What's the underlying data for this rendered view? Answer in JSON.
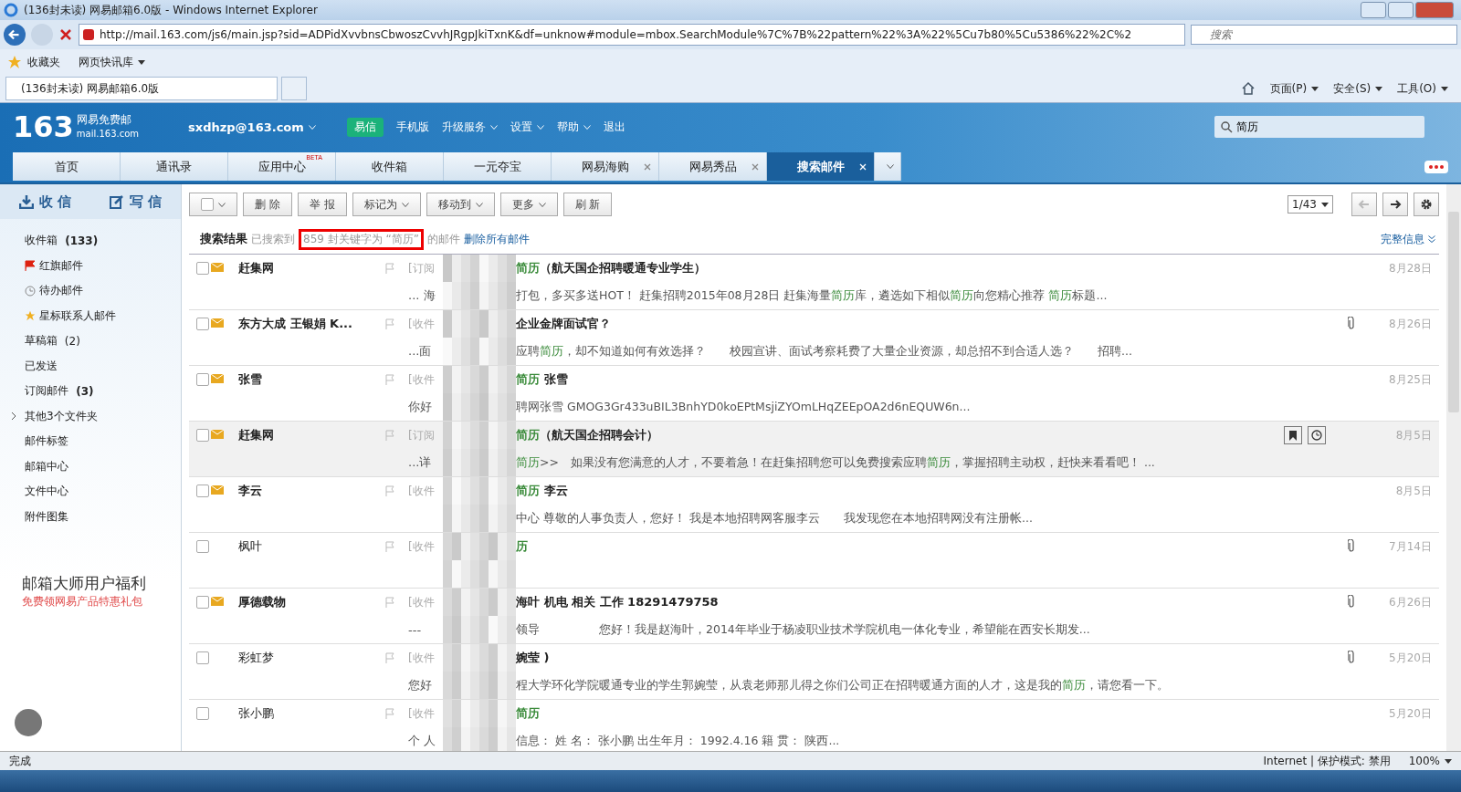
{
  "browser": {
    "title": "(136封未读) 网易邮箱6.0版 - Windows Internet Explorer",
    "url": "http://mail.163.com/js6/main.jsp?sid=ADPidXvvbnsCbwoszCvvhJRgpJkiTxnK&df=unknow#module=mbox.SearchModule%7C%7B%22pattern%22%3A%22%5Cu7b80%5Cu5386%22%2C%2",
    "search_placeholder": "搜索",
    "favorites": "收藏夹",
    "quick_links": "网页快讯库",
    "tab": "(136封未读) 网易邮箱6.0版",
    "commands": [
      "页面(P)",
      "安全(S)",
      "工具(O)"
    ]
  },
  "mail_header": {
    "logo_number": "163",
    "logo_name": "网易免费邮",
    "logo_domain": "mail.163.com",
    "account": "sxdhzp@163.com",
    "links": [
      {
        "label": "易信",
        "kind": "badge"
      },
      {
        "label": "手机版",
        "kind": "plain"
      },
      {
        "label": "升级服务",
        "kind": "menu"
      },
      {
        "label": "设置",
        "kind": "menu"
      },
      {
        "label": "帮助",
        "kind": "menu"
      },
      {
        "label": "退出",
        "kind": "plain"
      }
    ],
    "search_value": "简历"
  },
  "tabs": [
    {
      "label": "首页",
      "selected": false,
      "closable": false
    },
    {
      "label": "通讯录",
      "selected": false,
      "closable": false
    },
    {
      "label": "应用中心",
      "selected": false,
      "closable": false,
      "badge": "BETA"
    },
    {
      "label": "收件箱",
      "selected": false,
      "closable": false
    },
    {
      "label": "一元夺宝",
      "selected": false,
      "closable": false
    },
    {
      "label": "网易海购",
      "selected": false,
      "closable": true
    },
    {
      "label": "网易秀品",
      "selected": false,
      "closable": true
    },
    {
      "label": "搜索邮件",
      "selected": true,
      "closable": true
    }
  ],
  "sidebar": {
    "receive": "收 信",
    "write": "写 信",
    "folders": [
      {
        "kind": "plain",
        "label": "收件箱",
        "count": "(133)",
        "unread": true
      },
      {
        "kind": "flagged",
        "label": "红旗邮件"
      },
      {
        "kind": "todo",
        "label": "待办邮件"
      },
      {
        "kind": "starred",
        "label": "星标联系人邮件"
      },
      {
        "kind": "plain",
        "label": "草稿箱",
        "count": "(2)",
        "unread": false
      },
      {
        "kind": "plain",
        "label": "已发送"
      },
      {
        "kind": "plain",
        "label": "订阅邮件",
        "count": "(3)",
        "unread": true
      },
      {
        "kind": "group",
        "label": "其他3个文件夹",
        "expanded": false
      },
      {
        "kind": "plain",
        "label": "邮件标签"
      },
      {
        "kind": "plain",
        "label": "邮箱中心"
      },
      {
        "kind": "plain",
        "label": "文件中心"
      },
      {
        "kind": "plain",
        "label": "附件图集"
      }
    ],
    "promo_title": "邮箱大师用户福利",
    "promo_subtitle": "免费领网易产品特惠礼包"
  },
  "toolbar": {
    "select_all_checked": false,
    "buttons": [
      {
        "label": "删 除",
        "kind": "plain"
      },
      {
        "label": "举 报",
        "kind": "plain"
      },
      {
        "label": "标记为",
        "kind": "menu"
      },
      {
        "label": "移动到",
        "kind": "menu"
      },
      {
        "label": "更多",
        "kind": "menu"
      },
      {
        "label": "刷 新",
        "kind": "plain"
      }
    ],
    "pager": "1/43"
  },
  "search_summary": {
    "title": "搜索结果",
    "before": "已搜索到",
    "highlight": "859 封关键字为 “简历”",
    "after": "的邮件",
    "delete_link": "删除所有邮件",
    "detail_link": "完整信息"
  },
  "messages": [
    {
      "checked": false,
      "sender": "赶集网",
      "unread": true,
      "tag": "[订阅",
      "subject": [
        {
          "text": "简历",
          "hit": true
        },
        {
          "text": "（航天国企招聘暖通专业学生）",
          "hit": false
        }
      ],
      "preview_start": "... 海",
      "preview": [
        {
          "text": "打包，多买多送HOT！ 赶集招聘2015年08月28日 赶集海量",
          "hit": false
        },
        {
          "text": "简历",
          "hit": true
        },
        {
          "text": "库，遴选如下相似",
          "hit": false
        },
        {
          "text": "简历",
          "hit": true
        },
        {
          "text": "向您精心推荐 ",
          "hit": false
        },
        {
          "text": "简历",
          "hit": true
        },
        {
          "text": "标题...",
          "hit": false
        }
      ],
      "attachment": false,
      "hovered": false,
      "date": "8月28日"
    },
    {
      "checked": false,
      "sender": "东方大成 王银娟 K...",
      "unread": true,
      "tag": "[收件",
      "subject": [
        {
          "text": "企业金牌面试官？",
          "hit": false
        }
      ],
      "preview_start": "...面",
      "preview": [
        {
          "text": "应聘",
          "hit": false
        },
        {
          "text": "简历",
          "hit": true
        },
        {
          "text": "，却不知道如何有效选择？　　校园宣讲、面试考察耗费了大量企业资源，却总招不到合适人选？　　招聘...",
          "hit": false
        }
      ],
      "attachment": true,
      "hovered": false,
      "date": "8月26日"
    },
    {
      "checked": false,
      "sender": "张雪",
      "unread": true,
      "tag": "[收件",
      "subject": [
        {
          "text": "简历",
          "hit": true
        },
        {
          "text": " 张雪",
          "hit": false
        }
      ],
      "preview_start": "你好",
      "preview": [
        {
          "text": "聘网张雪 GMOG3Gr433uBIL3BnhYD0koEPtMsjiZYOmLHqZEEpOA2d6nEQUW6n...",
          "hit": false
        }
      ],
      "attachment": false,
      "hovered": false,
      "date": "8月25日"
    },
    {
      "checked": false,
      "sender": "赶集网",
      "unread": true,
      "tag": "[订阅",
      "subject": [
        {
          "text": "简历",
          "hit": true
        },
        {
          "text": "（航天国企招聘会计）",
          "hit": false
        }
      ],
      "preview_start": "...详",
      "preview": [
        {
          "text": "简历",
          "hit": true
        },
        {
          "text": ">>　如果没有您满意的人才，不要着急！在赶集招聘您可以免费搜索应聘",
          "hit": false
        },
        {
          "text": "简历",
          "hit": true
        },
        {
          "text": "，掌握招聘主动权，赶快来看看吧！ ...",
          "hit": false
        }
      ],
      "attachment": false,
      "hovered": true,
      "date": "8月5日"
    },
    {
      "checked": false,
      "sender": "李云",
      "unread": true,
      "tag": "[收件",
      "subject": [
        {
          "text": "简历",
          "hit": true
        },
        {
          "text": " 李云",
          "hit": false
        }
      ],
      "preview": [
        {
          "text": "中心  尊敬的人事负责人，您好！ 我是本地招聘网客服李云　　我发现您在本地招聘网没有注册帐...",
          "hit": false
        }
      ],
      "attachment": false,
      "hovered": false,
      "date": "8月5日"
    },
    {
      "checked": false,
      "sender": "枫叶",
      "unread": false,
      "tag": "[收件",
      "subject": [
        {
          "text": "历",
          "hit": true
        }
      ],
      "attachment": true,
      "hovered": false,
      "date": "7月14日"
    },
    {
      "checked": false,
      "sender": "厚德载物",
      "unread": true,
      "tag": "[收件",
      "subject": [
        {
          "text": "海叶 机电 相关 工作 18291479758",
          "hit": false
        }
      ],
      "preview_start": "---",
      "preview": [
        {
          "text": "领导　　　　　您好！我是赵海叶，2014年毕业于杨凌职业技术学院机电一体化专业，希望能在西安长期发...",
          "hit": false
        }
      ],
      "attachment": true,
      "hovered": false,
      "date": "6月26日"
    },
    {
      "checked": false,
      "sender": "彩虹梦",
      "unread": false,
      "tag": "[收件",
      "subject": [
        {
          "text": "婉莹 )",
          "hit": false
        }
      ],
      "preview_start": "您好",
      "preview": [
        {
          "text": "程大学环化学院暖通专业的学生郭婉莹，从袁老师那儿得之你们公司正在招聘暖通方面的人才，这是我的",
          "hit": false
        },
        {
          "text": "简历",
          "hit": true
        },
        {
          "text": "，请您看一下。",
          "hit": false
        }
      ],
      "attachment": true,
      "hovered": false,
      "date": "5月20日"
    },
    {
      "checked": false,
      "sender": "张小鹏",
      "unread": false,
      "tag": "[收件",
      "subject": [
        {
          "text": "简历",
          "hit": true
        }
      ],
      "preview_start": "个 人",
      "preview": [
        {
          "text": "信息： 姓 名： 张小鹏 出生年月： 1992.4.16 籍 贯： 陕西...",
          "hit": false
        }
      ],
      "attachment": false,
      "hovered": false,
      "date": "5月20日"
    }
  ],
  "status_bar": {
    "text": "完成",
    "zone": "Internet | 保护模式: 禁用",
    "zoom": "100%"
  }
}
